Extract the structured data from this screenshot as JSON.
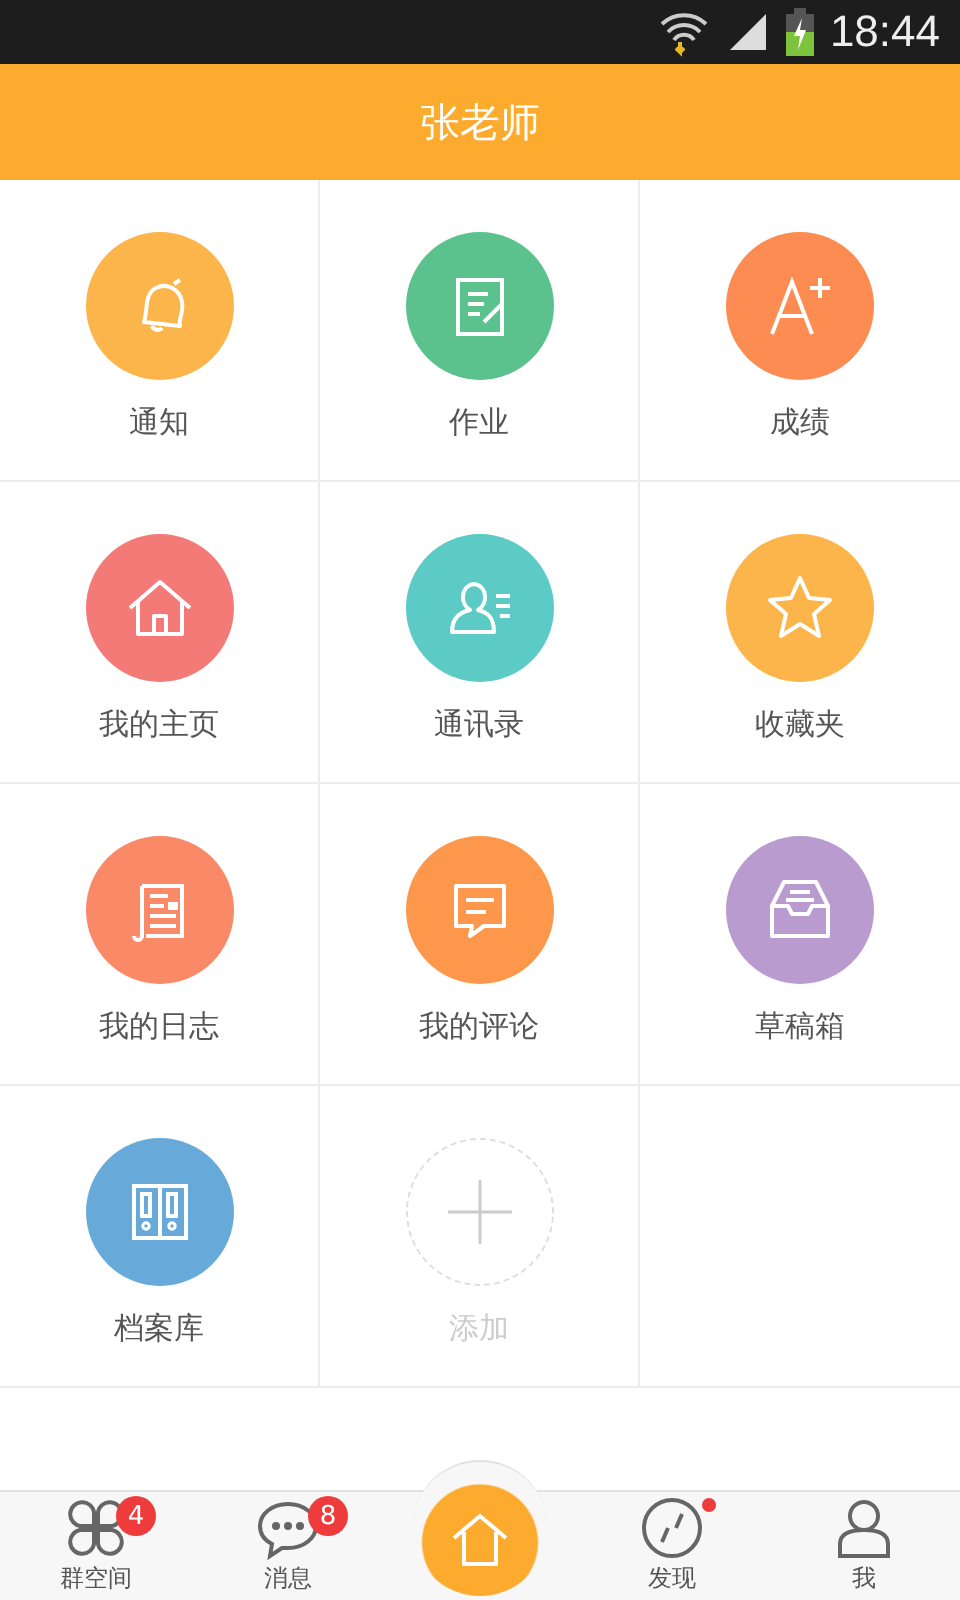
{
  "status_bar": {
    "time": "18:44"
  },
  "header": {
    "title": "张老师"
  },
  "tiles": [
    {
      "kind": "feature",
      "label": "通知",
      "color": "#fcb54a"
    },
    {
      "kind": "feature",
      "label": "作业",
      "color": "#5bc28e"
    },
    {
      "kind": "feature",
      "label": "成绩",
      "color": "#fc8c52"
    },
    {
      "kind": "feature",
      "label": "我的主页",
      "color": "#f47a78"
    },
    {
      "kind": "feature",
      "label": "通讯录",
      "color": "#5ccbc6"
    },
    {
      "kind": "feature",
      "label": "收藏夹",
      "color": "#fcb54a"
    },
    {
      "kind": "feature",
      "label": "我的日志",
      "color": "#f98967"
    },
    {
      "kind": "feature",
      "label": "我的评论",
      "color": "#fc974c"
    },
    {
      "kind": "feature",
      "label": "草稿箱",
      "color": "#b99bd0"
    },
    {
      "kind": "feature",
      "label": "档案库",
      "color": "#67a9d8"
    },
    {
      "kind": "add",
      "label": "添加"
    }
  ],
  "bottom_nav": [
    {
      "kind": "tab",
      "label": "群空间",
      "badge": "4"
    },
    {
      "kind": "tab",
      "label": "消息",
      "badge": "8"
    },
    {
      "kind": "home"
    },
    {
      "kind": "tab",
      "label": "发现",
      "dot": true
    },
    {
      "kind": "tab",
      "label": "我"
    }
  ]
}
